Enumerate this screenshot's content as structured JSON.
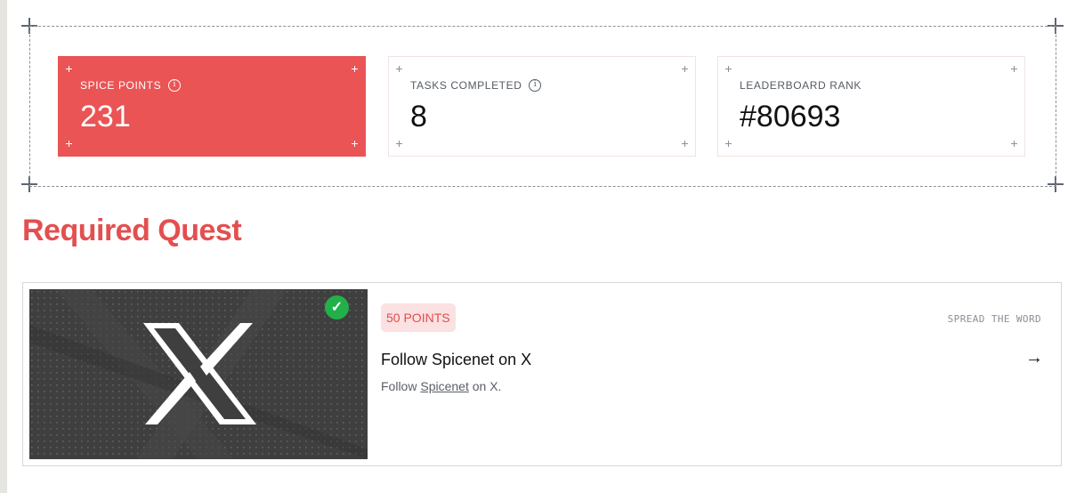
{
  "stats": [
    {
      "label": "SPICE POINTS",
      "value": "231",
      "has_info": true
    },
    {
      "label": "TASKS COMPLETED",
      "value": "8",
      "has_info": true
    },
    {
      "label": "LEADERBOARD RANK",
      "value": "#80693",
      "has_info": false
    }
  ],
  "colors": {
    "accent": "#ea5455",
    "title": "#e34f4f",
    "success": "#22b04b",
    "badge_bg": "#fbe1e1"
  },
  "section": {
    "title": "Required Quest"
  },
  "quest": {
    "points": "50 POINTS",
    "category": "SPREAD THE WORD",
    "title": "Follow Spicenet on X",
    "desc_prefix": "Follow",
    "desc_link": "Spicenet",
    "desc_suffix": "on X.",
    "completed_icon": "check-icon",
    "action_icon": "arrow-right-icon",
    "image_icon": "x-logo-icon"
  }
}
